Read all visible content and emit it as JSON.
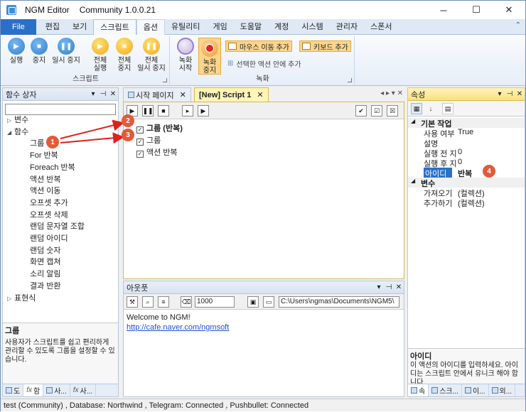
{
  "window": {
    "app_name": "NGM Editor",
    "edition": "Community 1.0.0.21"
  },
  "tabs": [
    "File",
    "편집",
    "보기",
    "스크립트",
    "옵션",
    "유틸리티",
    "게임",
    "도움말",
    "계정",
    "시스템",
    "관리자",
    "스폰서"
  ],
  "ribbon": {
    "script_group_label": "스크립트",
    "record_group_label": "녹화",
    "buttons": {
      "run": "실행",
      "stop": "중지",
      "pause": "일시 중지",
      "run_all_1": "전체",
      "run_all_2": "실행",
      "stop_all_1": "전체",
      "stop_all_2": "중지",
      "pause_all_1": "전체",
      "pause_all_2": "일시 중지",
      "rec_start_1": "녹화",
      "rec_start_2": "시작",
      "rec_stop_1": "녹화",
      "rec_stop_2": "중지"
    },
    "mouse_move_add": "마우스 이동 추가",
    "keyboard_add": "키보드 추가",
    "add_in_selected": "선택한 액션 안에 추가"
  },
  "function_box": {
    "title": "함수 상자",
    "tree": [
      {
        "label": "변수",
        "kind": "collapsed"
      },
      {
        "label": "함수",
        "kind": "expanded"
      },
      {
        "label": "그룹",
        "kind": "child"
      },
      {
        "label": "For 반복",
        "kind": "child"
      },
      {
        "label": "Foreach 반복",
        "kind": "child"
      },
      {
        "label": "액션 반복",
        "kind": "child"
      },
      {
        "label": "액션 이동",
        "kind": "child"
      },
      {
        "label": "오프셋 추가",
        "kind": "child"
      },
      {
        "label": "오프셋 삭제",
        "kind": "child"
      },
      {
        "label": "랜덤 문자열 조합",
        "kind": "child"
      },
      {
        "label": "랜덤 아이디",
        "kind": "child"
      },
      {
        "label": "랜덤 숫자",
        "kind": "child"
      },
      {
        "label": "화면 캡쳐",
        "kind": "child"
      },
      {
        "label": "소리 알림",
        "kind": "child"
      },
      {
        "label": "결과 반환",
        "kind": "child"
      },
      {
        "label": "표현식",
        "kind": "collapsed"
      }
    ],
    "desc_title": "그룹",
    "desc_text": "사용자가 스크립트를 쉽고 편리하게 관리할 수 있도록 그룹을 설정할 수 있습니다.",
    "bottom_tabs": [
      "도",
      "함",
      "사...",
      "사..."
    ]
  },
  "editor": {
    "tab_start": "시작 페이지",
    "tab_script": "[New] Script 1",
    "actions": [
      {
        "label": "그룹 (반복)",
        "bold": true
      },
      {
        "label": "그룹",
        "bold": false
      },
      {
        "label": "액션 반복",
        "bold": false
      }
    ]
  },
  "output": {
    "title": "아웃풋",
    "count": "1000",
    "path": "C:\\Users\\ngmas\\Documents\\NGM5\\",
    "line1": "Welcome to NGM!",
    "link": "http://cafe.naver.com/ngmsoft"
  },
  "properties": {
    "title": "속성",
    "cat_basic": "기본 작업",
    "rows": [
      {
        "k": "사용 여부",
        "v": "True"
      },
      {
        "k": "설명",
        "v": ""
      },
      {
        "k": "실행 전 지",
        "v": "0"
      },
      {
        "k": "실행 후 지",
        "v": "0"
      },
      {
        "k": "아이디",
        "v": "반복"
      }
    ],
    "cat_var": "변수",
    "var_rows": [
      {
        "k": "가져오기",
        "v": "(컬렉션)"
      },
      {
        "k": "추가하기",
        "v": "(컬렉션)"
      }
    ],
    "desc_title": "아이디",
    "desc_text": "이 액션의 아이디를 입력하세요. 아이디는 스크립트 안에서 유니크 해야 합니다.",
    "bottom_tabs": [
      "속",
      "스크...",
      "이...",
      "외..."
    ]
  },
  "badges": [
    "1",
    "2",
    "3",
    "4"
  ],
  "status": {
    "user": "test (Community)",
    "database": ", Database: Northwind",
    "telegram": ", Telegram: Connected",
    "pushbullet": ", Pushbullet: Connected"
  }
}
